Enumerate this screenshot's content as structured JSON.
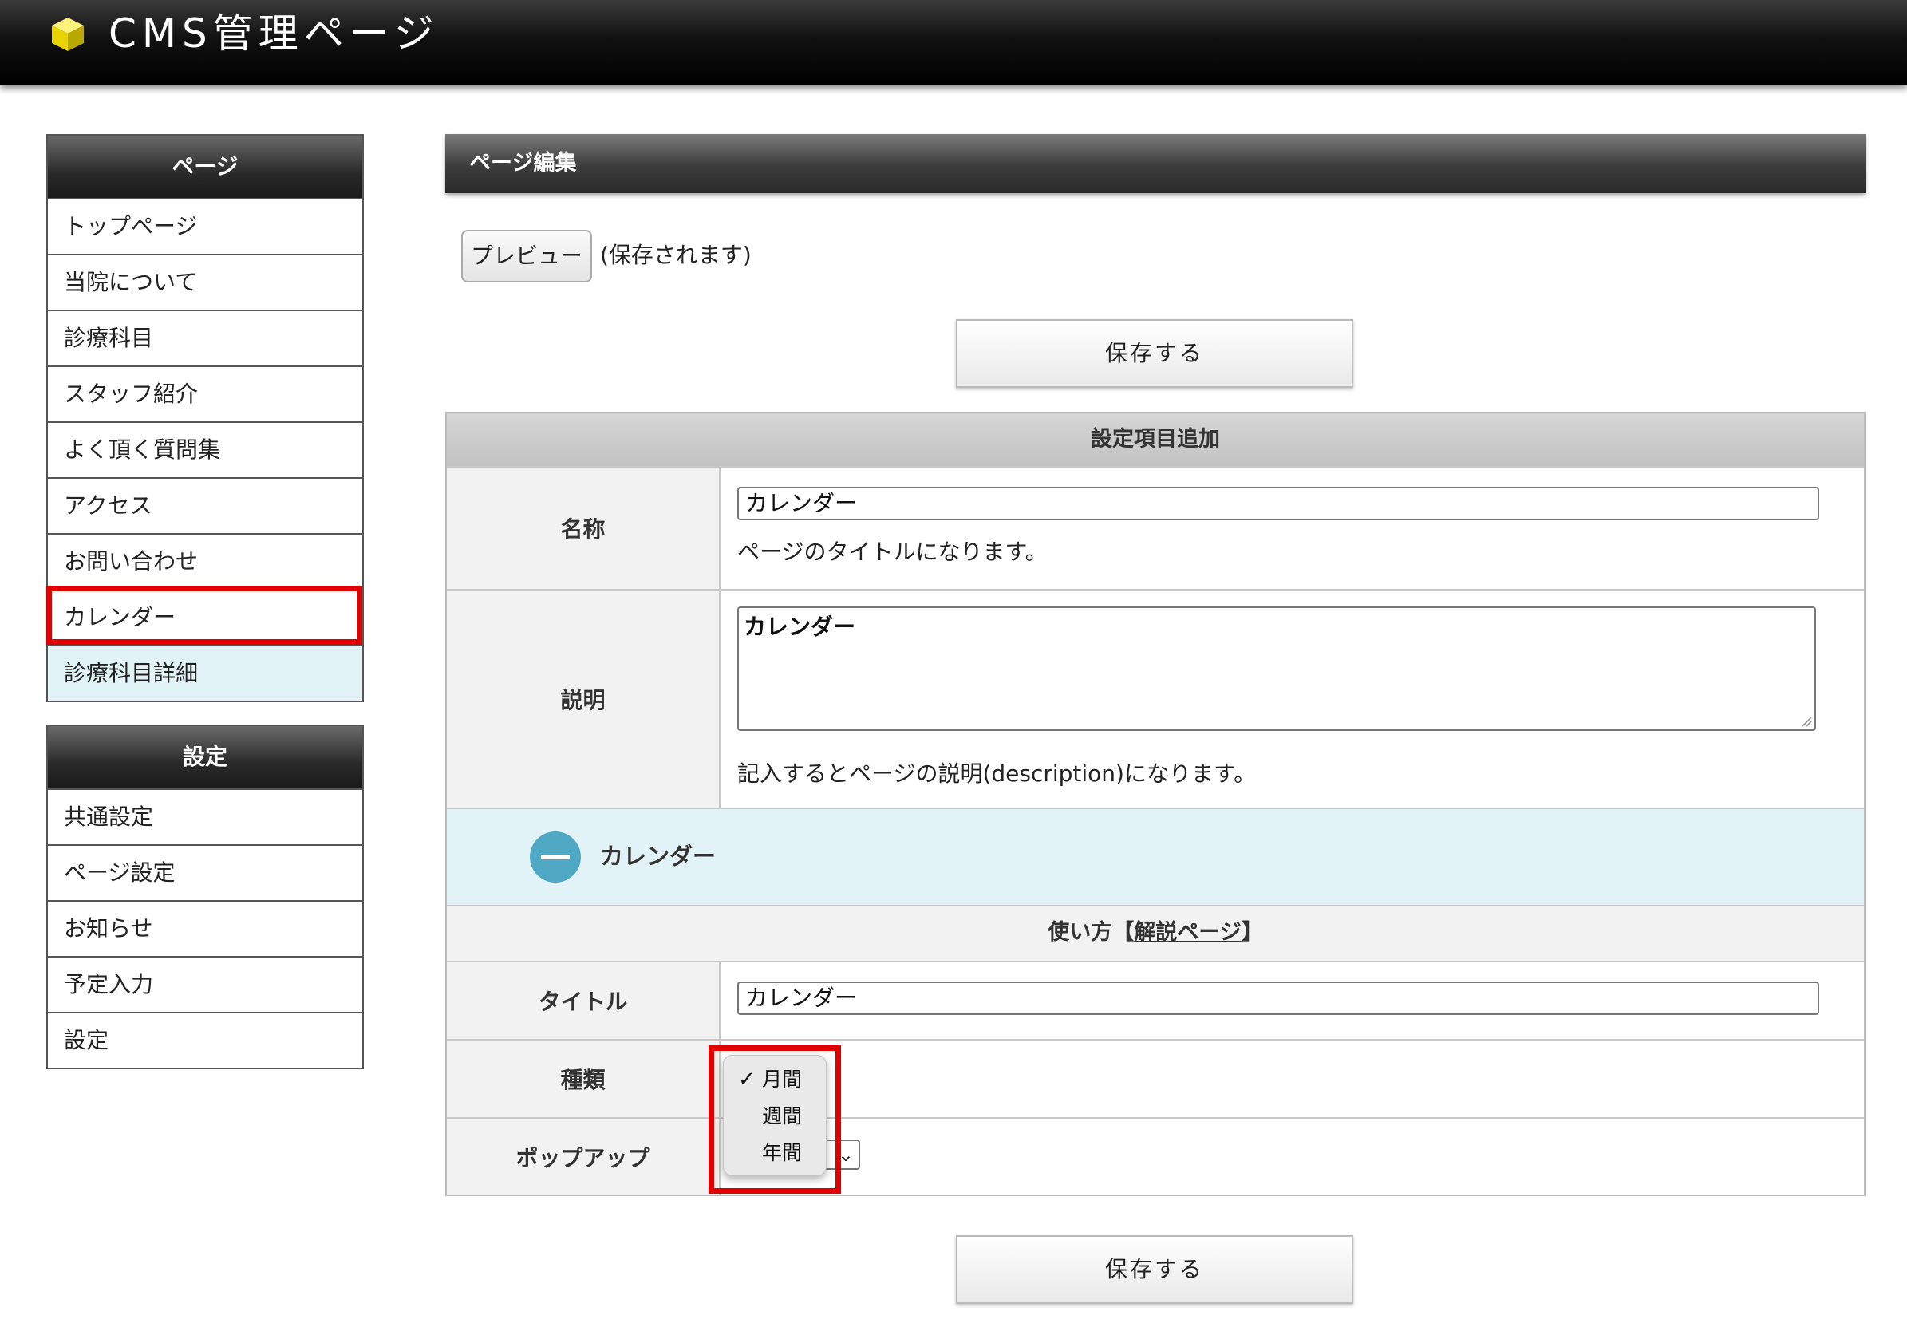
{
  "header": {
    "title": "CMS管理ページ",
    "logo_icon": "yellow-cube-icon"
  },
  "sidebar": {
    "pages_heading": "ページ",
    "pages": [
      {
        "label": "トップページ"
      },
      {
        "label": "当院について"
      },
      {
        "label": "診療科目"
      },
      {
        "label": "スタッフ紹介"
      },
      {
        "label": "よく頂く質問集"
      },
      {
        "label": "アクセス"
      },
      {
        "label": "お問い合わせ"
      },
      {
        "label": "カレンダー",
        "outlined": true
      },
      {
        "label": "診療科目詳細",
        "selected": true
      }
    ],
    "settings_heading": "設定",
    "settings": [
      {
        "label": "共通設定"
      },
      {
        "label": "ページ設定"
      },
      {
        "label": "お知らせ"
      },
      {
        "label": "予定入力"
      },
      {
        "label": "設定"
      }
    ]
  },
  "main": {
    "section_title": "ページ編集",
    "preview_button": "プレビュー",
    "preview_note": "(保存されます)",
    "save_button": "保存する",
    "form": {
      "band_title": "設定項目追加",
      "name_label": "名称",
      "name_value": "カレンダー",
      "name_help": "ページのタイトルになります。",
      "description_label": "説明",
      "description_value": "カレンダー",
      "description_help": "記入するとページの説明(description)になります。",
      "block_title": "カレンダー",
      "usage_prefix": "使い方【",
      "usage_link": "解説ページ",
      "usage_suffix": "】",
      "title_label": "タイトル",
      "title_value": "カレンダー",
      "type_label": "種類",
      "type_options": [
        "月間",
        "週間",
        "年間"
      ],
      "type_selected": "月間",
      "popup_label": "ポップアップ"
    }
  },
  "colors": {
    "highlight_outline": "#e00000",
    "selected_bg": "#e2f3f8",
    "accent_circle": "#4fa8c4"
  }
}
